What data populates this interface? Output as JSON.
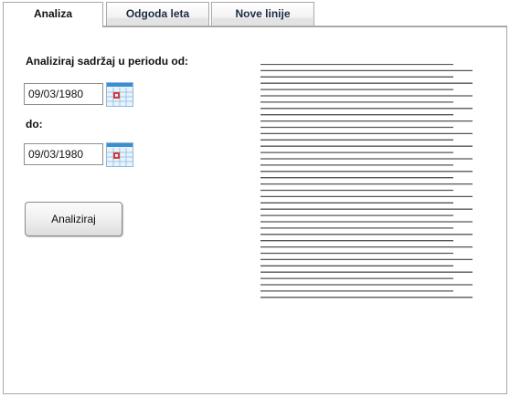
{
  "tabs": [
    {
      "label": "Analiza",
      "active": true
    },
    {
      "label": "Odgoda leta",
      "active": false
    },
    {
      "label": "Nove linije",
      "active": false
    }
  ],
  "analysis": {
    "period_label": "Analiziraj sadržaj u periodu od:",
    "from_date": "09/03/1980",
    "to_label": "do:",
    "to_date": "09/03/1980",
    "analyze_button": "Analiziraj"
  },
  "icons": {
    "calendar": "calendar-icon"
  },
  "colors": {
    "calendar_blue": "#3a8fd0",
    "calendar_red": "#d63a3a",
    "tab_border": "#a9a9a9",
    "text_lines": "#555555"
  },
  "content_lines": 38
}
